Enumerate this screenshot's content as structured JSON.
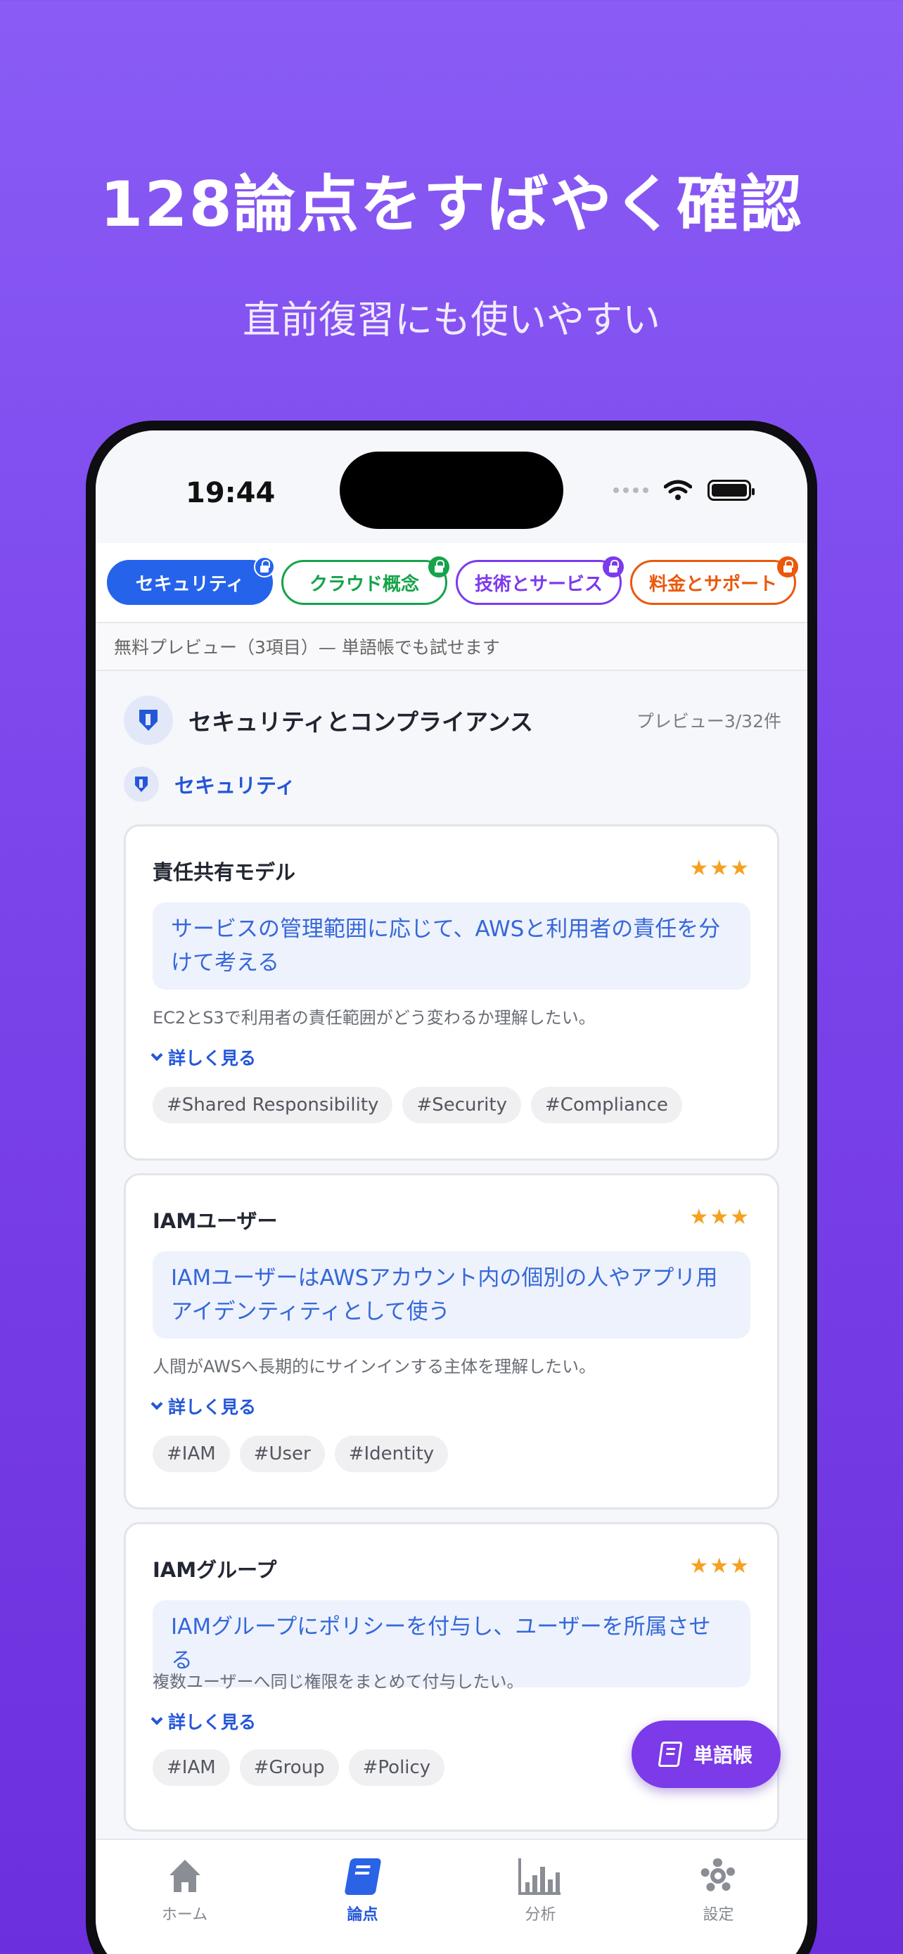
{
  "promo": {
    "headline": "128論点をすばやく確認",
    "subheadline": "直前復習にも使いやすい"
  },
  "status_bar": {
    "time": "19:44"
  },
  "category_chips": [
    {
      "label": "セキュリティ",
      "color": "#2563eb",
      "selected": true,
      "locked": true
    },
    {
      "label": "クラウド概念",
      "color": "#16a34a",
      "selected": false,
      "locked": true
    },
    {
      "label": "技術とサービス",
      "color": "#7c3aed",
      "selected": false,
      "locked": true
    },
    {
      "label": "料金とサポート",
      "color": "#ea580c",
      "selected": false,
      "locked": true
    }
  ],
  "preview_banner": "無料プレビュー（3項目）— 単語帳でも試せます",
  "section": {
    "title": "セキュリティとコンプライアンス",
    "count": "プレビュー3/32件",
    "category": "セキュリティ"
  },
  "cards": [
    {
      "title": "責任共有モデル",
      "stars": "★★★",
      "highlight": "サービスの管理範囲に応じて、AWSと利用者の責任を分けて考える",
      "description": "EC2とS3で利用者の責任範囲がどう変わるか理解したい。",
      "more": "詳しく見る",
      "tags": [
        "#Shared Responsibility",
        "#Security",
        "#Compliance"
      ]
    },
    {
      "title": "IAMユーザー",
      "stars": "★★★",
      "highlight": "IAMユーザーはAWSアカウント内の個別の人やアプリ用アイデンティティとして使う",
      "description": "人間がAWSへ長期的にサインインする主体を理解したい。",
      "more": "詳しく見る",
      "tags": [
        "#IAM",
        "#User",
        "#Identity"
      ]
    },
    {
      "title": "IAMグループ",
      "stars": "★★★",
      "highlight": "IAMグループにポリシーを付与し、ユーザーを所属させる",
      "description": "複数ユーザーへ同じ権限をまとめて付与したい。",
      "more": "詳しく見る",
      "tags": [
        "#IAM",
        "#Group",
        "#Policy"
      ]
    }
  ],
  "fab": {
    "label": "単語帳",
    "icon": "book-icon"
  },
  "tab_bar": [
    {
      "label": "ホーム",
      "icon": "home-icon",
      "active": false
    },
    {
      "label": "論点",
      "icon": "book-icon",
      "active": true
    },
    {
      "label": "分析",
      "icon": "chart-icon",
      "active": false
    },
    {
      "label": "設定",
      "icon": "gear-icon",
      "active": false
    }
  ],
  "colors": {
    "accent": "#2457d8",
    "fab": "#7c3ae8",
    "star": "#f7a01f",
    "background_top": "#8a5cf5"
  }
}
